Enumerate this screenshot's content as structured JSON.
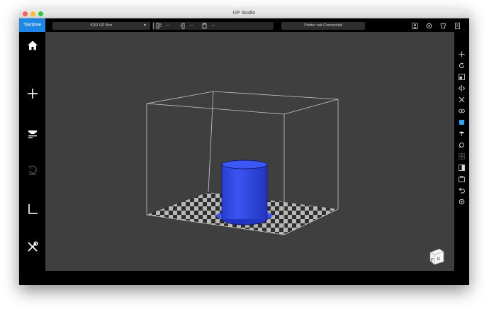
{
  "window": {
    "title": "UP Studio"
  },
  "logo": {
    "text": "Tiertime"
  },
  "printer_select": {
    "value": "K3D UP Box"
  },
  "toolbar": {
    "stat1": "---",
    "stat2": "---",
    "stat3": "---"
  },
  "printer_status": "Printer not Connected",
  "view_cube": {
    "front": "F",
    "right": "R"
  },
  "colors": {
    "accent": "#1b87e6",
    "model": "#2f47e3",
    "viewport": "#3f3f3f"
  },
  "icons": {
    "sidebar": [
      "home-icon",
      "add-icon",
      "print-icon",
      "calibrate-icon",
      "level-icon",
      "maintenance-icon"
    ],
    "right_toolbar": [
      "move-icon",
      "rotate-icon",
      "scale-icon",
      "mirror-icon",
      "cross-icon",
      "view-icon",
      "color-icon",
      "support-icon",
      "repair-icon",
      "layout-icon",
      "split-icon",
      "save-icon",
      "undo-icon",
      "settings-icon"
    ]
  }
}
